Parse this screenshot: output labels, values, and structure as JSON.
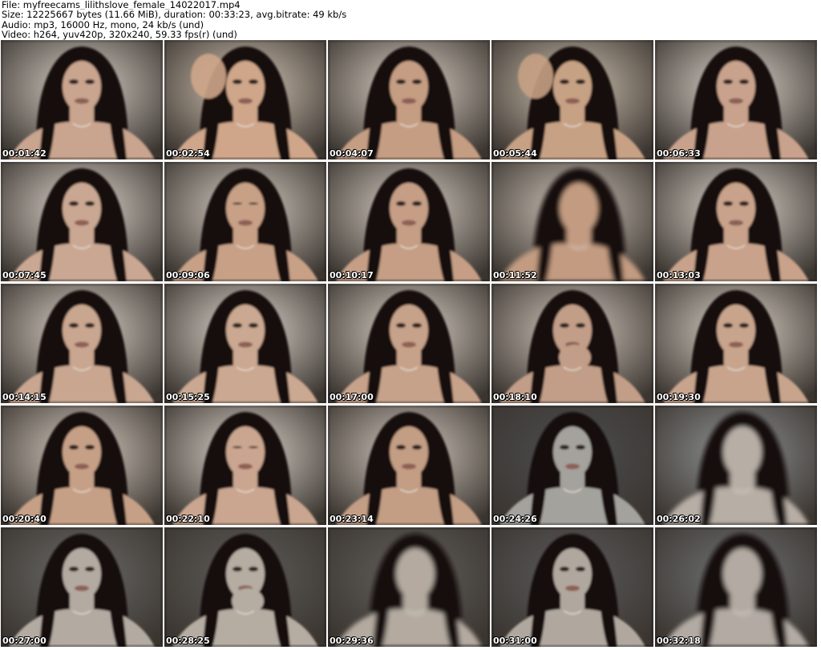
{
  "header": {
    "file": "File: myfreecams_lilithslove_female_14022017.mp4",
    "size": "Size: 12225667 bytes (11.66 MiB), duration: 00:33:23, avg.bitrate: 49 kb/s",
    "audio": "Audio: mp3, 16000 Hz, mono, 24 kb/s (und)",
    "video": "Video: h264, yuv420p, 320x240, 59.33 fps(r) (und)"
  },
  "thumbnails": [
    {
      "timestamp": "00:01:42",
      "bg": "#d9d2c9",
      "skin": "#c9a48e",
      "pose": "center"
    },
    {
      "timestamp": "00:02:54",
      "bg": "#d6c8b8",
      "skin": "#cfa68a",
      "pose": "hand-hair"
    },
    {
      "timestamp": "00:04:07",
      "bg": "#dcd3c7",
      "skin": "#c59d83",
      "pose": "center"
    },
    {
      "timestamp": "00:05:44",
      "bg": "#cfc2b1",
      "skin": "#c7a184",
      "pose": "hand-hair"
    },
    {
      "timestamp": "00:06:33",
      "bg": "#ddd6cd",
      "skin": "#c8a28c",
      "pose": "center"
    },
    {
      "timestamp": "00:07:45",
      "bg": "#e0d8cf",
      "skin": "#caa792",
      "pose": "center"
    },
    {
      "timestamp": "00:09:06",
      "bg": "#d7cfc4",
      "skin": "#c7a086",
      "pose": "eyes-closed"
    },
    {
      "timestamp": "00:10:17",
      "bg": "#d8d0c5",
      "skin": "#c59e85",
      "pose": "center"
    },
    {
      "timestamp": "00:11:52",
      "bg": "#cfc6ba",
      "skin": "#c29b81",
      "pose": "blur"
    },
    {
      "timestamp": "00:13:03",
      "bg": "#dcd5cc",
      "skin": "#c8a28a",
      "pose": "center"
    },
    {
      "timestamp": "00:14:15",
      "bg": "#ddd5cb",
      "skin": "#c9a690",
      "pose": "center"
    },
    {
      "timestamp": "00:15:25",
      "bg": "#e0d9d0",
      "skin": "#cba891",
      "pose": "center"
    },
    {
      "timestamp": "00:17:00",
      "bg": "#dbd3c8",
      "skin": "#c7a28a",
      "pose": "center"
    },
    {
      "timestamp": "00:18:10",
      "bg": "#d2c9be",
      "skin": "#c29e88",
      "pose": "hand-face"
    },
    {
      "timestamp": "00:19:30",
      "bg": "#dcd4c9",
      "skin": "#c8a48c",
      "pose": "center"
    },
    {
      "timestamp": "00:20:40",
      "bg": "#d8cfc3",
      "skin": "#c6a086",
      "pose": "center"
    },
    {
      "timestamp": "00:22:10",
      "bg": "#ddd6cd",
      "skin": "#caa690",
      "pose": "eyes-closed"
    },
    {
      "timestamp": "00:23:14",
      "bg": "#d4cbc0",
      "skin": "#c39d84",
      "pose": "center"
    },
    {
      "timestamp": "00:24:26",
      "bg": "#4c4e50",
      "skin": "#a4a29d",
      "pose": "dark"
    },
    {
      "timestamp": "00:26:02",
      "bg": "#8f9394",
      "skin": "#b7aea5",
      "pose": "blur"
    },
    {
      "timestamp": "00:27:00",
      "bg": "#6a6a68",
      "skin": "#b3aaa1",
      "pose": "dark"
    },
    {
      "timestamp": "00:28:25",
      "bg": "#5e5d5a",
      "skin": "#b5aca2",
      "pose": "hand-face"
    },
    {
      "timestamp": "00:29:36",
      "bg": "#615f5b",
      "skin": "#b4aaa0",
      "pose": "blur"
    },
    {
      "timestamp": "00:31:00",
      "bg": "#5a5b5c",
      "skin": "#b0a89f",
      "pose": "dark"
    },
    {
      "timestamp": "00:32:18",
      "bg": "#6f7274",
      "skin": "#b3aba3",
      "pose": "blur"
    }
  ]
}
